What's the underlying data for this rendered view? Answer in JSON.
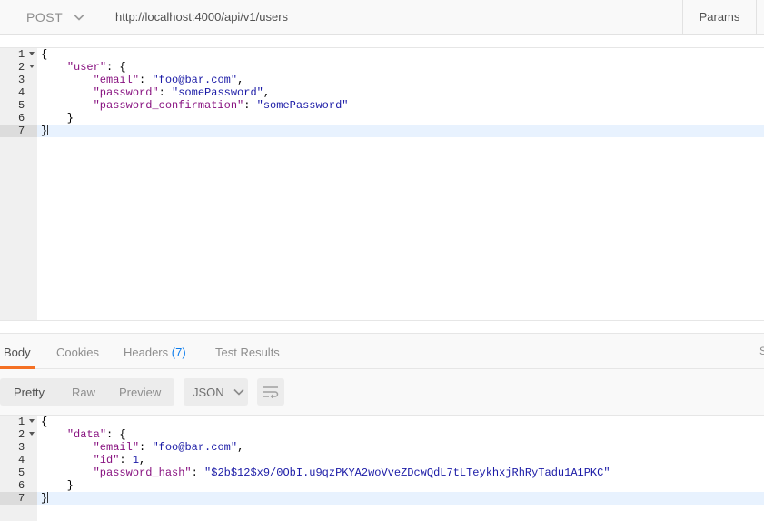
{
  "request": {
    "method": "POST",
    "url": "http://localhost:4000/api/v1/users",
    "params_label": "Params",
    "body_lines": [
      {
        "n": "1",
        "fold": true,
        "text": "{"
      },
      {
        "n": "2",
        "fold": true,
        "text": "    \"user\": {"
      },
      {
        "n": "3",
        "fold": false,
        "text": "        \"email\": \"foo@bar.com\","
      },
      {
        "n": "4",
        "fold": false,
        "text": "        \"password\": \"somePassword\","
      },
      {
        "n": "5",
        "fold": false,
        "text": "        \"password_confirmation\": \"somePassword\""
      },
      {
        "n": "6",
        "fold": false,
        "text": "    }"
      },
      {
        "n": "7",
        "fold": false,
        "text": "}"
      }
    ]
  },
  "response": {
    "tabs": [
      {
        "label": "Body",
        "count": "",
        "active": true
      },
      {
        "label": "Cookies",
        "count": "",
        "active": false
      },
      {
        "label": "Headers",
        "count": "(7)",
        "active": false
      },
      {
        "label": "Test Results",
        "count": "",
        "active": false
      }
    ],
    "overflow_tab": "S",
    "view_modes": [
      "Pretty",
      "Raw",
      "Preview"
    ],
    "selected_mode": "Pretty",
    "format": "JSON",
    "body_lines": [
      {
        "n": "1",
        "fold": true,
        "text": "{"
      },
      {
        "n": "2",
        "fold": true,
        "text": "    \"data\": {"
      },
      {
        "n": "3",
        "fold": false,
        "text": "        \"email\": \"foo@bar.com\","
      },
      {
        "n": "4",
        "fold": false,
        "text": "        \"id\": 1,"
      },
      {
        "n": "5",
        "fold": false,
        "text": "        \"password_hash\": \"$2b$12$x9/0ObI.u9qzPKYA2woVveZDcwQdL7tLTeykhxjRhRyTadu1A1PKC\""
      },
      {
        "n": "6",
        "fold": false,
        "text": "    }"
      },
      {
        "n": "7",
        "fold": false,
        "text": "}"
      }
    ]
  },
  "icons": {
    "method_dropdown": "chevron-down-icon",
    "format_dropdown": "chevron-down-icon",
    "wrap": "wrap-lines-icon"
  },
  "colors": {
    "accent": "#f47023",
    "header_count": "#097bed",
    "json_key": "#881280",
    "json_string": "#1a1aa6"
  }
}
